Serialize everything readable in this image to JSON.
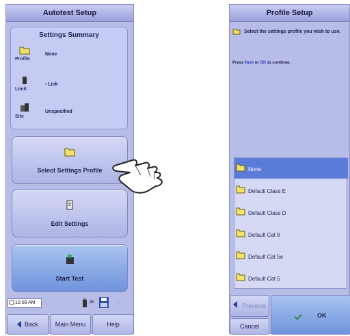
{
  "left_panel": {
    "title": "Autotest Setup",
    "summary": {
      "title": "Settings Summary",
      "rows": [
        {
          "label": "Profile",
          "value": "None",
          "icon": "folder-icon"
        },
        {
          "label": "Limit",
          "value": "- Link",
          "icon": "limit-icon"
        },
        {
          "label": "Site",
          "value": "Unspecified",
          "icon": "site-icon"
        }
      ]
    },
    "buttons": {
      "select_profile": "Select Settings Profile",
      "edit_settings": "Edit Settings",
      "start_test": "Start Test"
    },
    "status": {
      "time": "10:08 AM",
      "battery": "ac"
    },
    "nav": {
      "back": "Back",
      "main_menu": "Main Menu",
      "help": "Help"
    }
  },
  "right_panel": {
    "title": "Profile Setup",
    "instruction": "Select the settings profile you wish to use.",
    "press_prefix": "Press",
    "next_word": "Next",
    "or_word": "or",
    "ok_word": "OK",
    "press_suffix": "to continue.",
    "profiles": [
      {
        "name": "None",
        "selected": true
      },
      {
        "name": "Default Class E",
        "selected": false
      },
      {
        "name": "Default Class D",
        "selected": false
      },
      {
        "name": "Default Cat 6",
        "selected": false
      },
      {
        "name": "Default Cat 5e",
        "selected": false
      },
      {
        "name": "Default Cat 5",
        "selected": false
      }
    ],
    "buttons": {
      "previous": "Previous",
      "cancel": "Cancel",
      "ok": "OK"
    }
  },
  "colors": {
    "panel_bg": "#b8bde8",
    "selected_bg": "#5b7bd8",
    "primary_button": "#7d9ce0"
  }
}
